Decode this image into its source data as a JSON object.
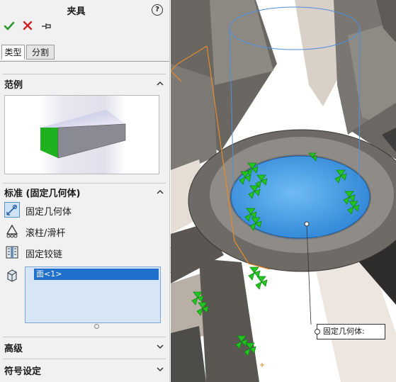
{
  "panel": {
    "title": "夹具",
    "help_icon": "?",
    "tabs": [
      {
        "label": "类型",
        "active": true
      },
      {
        "label": "分割",
        "active": false
      }
    ],
    "sections": {
      "example": {
        "title": "范例"
      },
      "standard": {
        "title": "标准 (固定几何体)",
        "options": [
          {
            "label": "固定几何体",
            "icon": "fixed-geometry-icon",
            "selected": true
          },
          {
            "label": "滚柱/滑杆",
            "icon": "roller-slider-icon",
            "selected": false
          },
          {
            "label": "固定铰链",
            "icon": "fixed-hinge-icon",
            "selected": false
          }
        ],
        "selection_list": [
          "面<1>"
        ]
      },
      "advanced": {
        "title": "高级"
      },
      "symbol_settings": {
        "title": "符号设定"
      }
    }
  },
  "viewport": {
    "callout_label": "固定几何体:"
  },
  "colors": {
    "accept": "#2a9a2a",
    "cancel": "#d21f1f",
    "selected_face": "#4aa3e8",
    "fixture_arrows": "#22c422",
    "sketch_orange": "#e58a2a",
    "preview_cylinder": "#4f8fe0"
  }
}
